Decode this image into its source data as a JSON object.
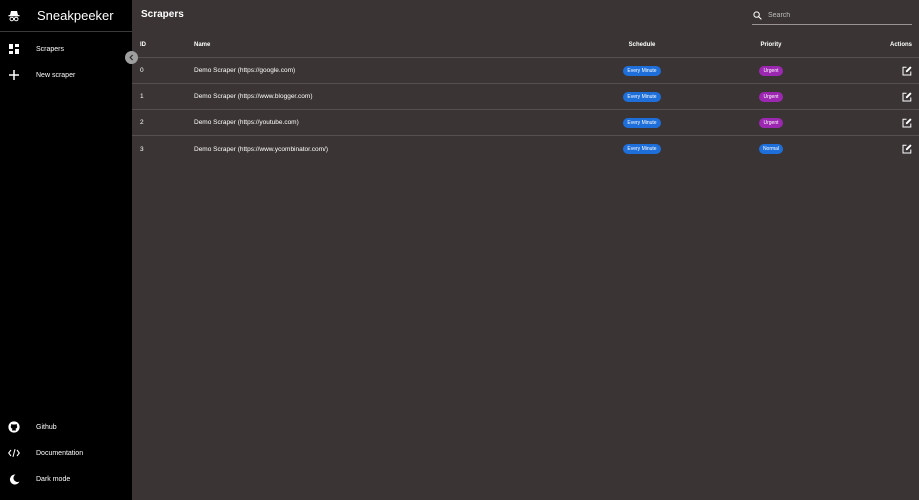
{
  "app": {
    "title": "Sneakpeeker"
  },
  "sidebar": {
    "items": [
      {
        "label": "Scrapers",
        "icon": "dashboard-icon"
      },
      {
        "label": "New scraper",
        "icon": "plus-icon"
      }
    ],
    "bottom_items": [
      {
        "label": "Github",
        "icon": "github-icon"
      },
      {
        "label": "Documentation",
        "icon": "code-icon"
      },
      {
        "label": "Dark mode",
        "icon": "moon-icon"
      }
    ]
  },
  "header": {
    "title": "Scrapers"
  },
  "search": {
    "placeholder": "Search",
    "value": ""
  },
  "table": {
    "columns": [
      "ID",
      "Name",
      "Schedule",
      "Priority",
      "Actions"
    ],
    "rows": [
      {
        "id": "0",
        "name": "Demo Scraper (https://google.com)",
        "schedule": "Every Minute",
        "priority": "Urgent"
      },
      {
        "id": "1",
        "name": "Demo Scraper (https://www.blogger.com)",
        "schedule": "Every Minute",
        "priority": "Urgent"
      },
      {
        "id": "2",
        "name": "Demo Scraper (https://youtube.com)",
        "schedule": "Every Minute",
        "priority": "Urgent"
      },
      {
        "id": "3",
        "name": "Demo Scraper (https://www.ycombinator.com/)",
        "schedule": "Every Minute",
        "priority": "Normal"
      }
    ]
  },
  "colors": {
    "background": "#3a3434",
    "sidebar": "#000000",
    "schedule_badge": "#1e6fd9",
    "urgent_badge": "#9c27b0",
    "normal_badge": "#1e6fd9"
  }
}
